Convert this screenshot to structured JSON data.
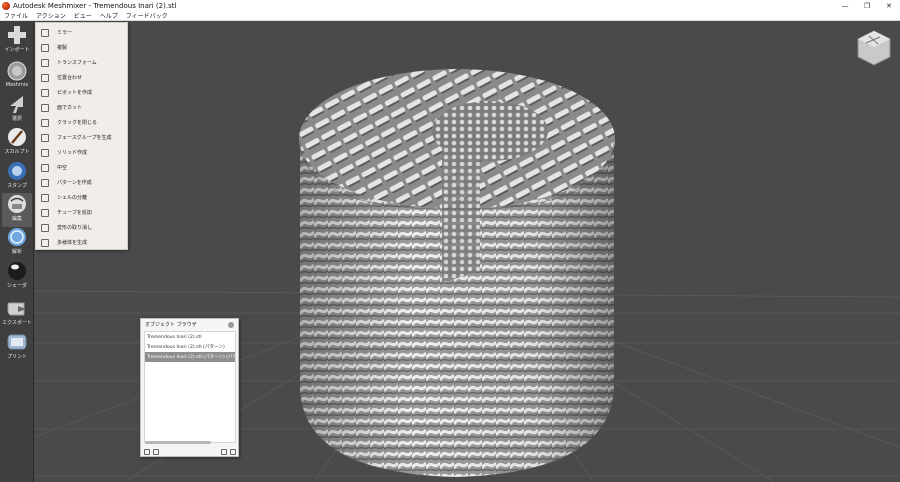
{
  "window": {
    "title": "Autodesk Meshmixer - Tremendous Inari (2).stl",
    "controls": [
      "—",
      "❐",
      "✕"
    ]
  },
  "menu": [
    "ファイル",
    "アクション",
    "ビュー",
    "ヘルプ",
    "フィードバック"
  ],
  "toolbar": [
    {
      "label": "インポート",
      "icon": "plus-icon"
    },
    {
      "label": "Meshmix",
      "icon": "meshmix-ball-icon"
    },
    {
      "label": "選択",
      "icon": "select-arrow-icon"
    },
    {
      "label": "スカルプト",
      "icon": "brush-icon"
    },
    {
      "label": "スタンプ",
      "icon": "stamp-icon"
    },
    {
      "label": "編集",
      "icon": "edit-icon"
    },
    {
      "label": "解析",
      "icon": "analysis-icon"
    },
    {
      "label": "シェーダ",
      "icon": "shader-sphere-icon"
    },
    {
      "label": "エクスポート",
      "icon": "export-icon"
    },
    {
      "label": "プリント",
      "icon": "print-icon"
    }
  ],
  "edit_menu": [
    {
      "label": "ミラー",
      "icon": "mirror-icon"
    },
    {
      "label": "複製",
      "icon": "duplicate-icon"
    },
    {
      "label": "トランスフォーム",
      "icon": "transform-icon"
    },
    {
      "label": "位置合わせ",
      "icon": "align-icon"
    },
    {
      "label": "ピボットを作成",
      "icon": "pivot-icon"
    },
    {
      "label": "面でカット",
      "icon": "plane-cut-icon"
    },
    {
      "label": "クラックを閉じる",
      "icon": "close-cracks-icon"
    },
    {
      "label": "フェースグループを生成",
      "icon": "facegroups-icon"
    },
    {
      "label": "ソリッド作成",
      "icon": "make-solid-icon"
    },
    {
      "label": "中空",
      "icon": "hollow-icon"
    },
    {
      "label": "パターンを作成",
      "icon": "make-pattern-icon"
    },
    {
      "label": "シェルの分離",
      "icon": "separate-shells-icon"
    },
    {
      "label": "チューブを追加",
      "icon": "add-tube-icon"
    },
    {
      "label": "変形の取り消し",
      "icon": "replace-icon"
    },
    {
      "label": "多様体を生成",
      "icon": "make-manifold-icon"
    }
  ],
  "object_browser": {
    "title": "オブジェクト ブラウザ",
    "items": [
      {
        "label": "Tremendous Inari (2).stl",
        "selected": false
      },
      {
        "label": "Tremendous Inari (2).stl (パターン)",
        "selected": false
      },
      {
        "label": "Tremendous Inari (2).stl (パターン) (パター",
        "selected": true
      }
    ]
  },
  "colors": {
    "viewport_bg": "#4a4a4a",
    "grid_line": "#5a5a5a",
    "mesh_light": "#e6e6e6",
    "mesh_shadow": "#7a7a7a"
  }
}
